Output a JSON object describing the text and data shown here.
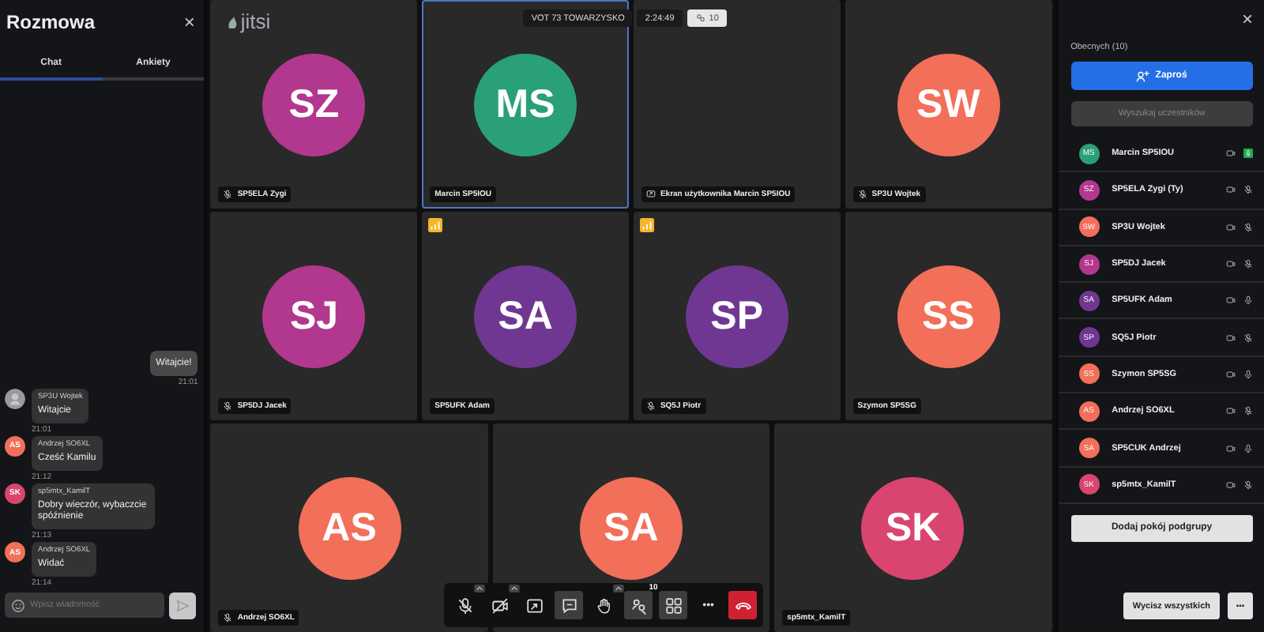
{
  "chat": {
    "title": "Rozmowa",
    "close": "×",
    "tabs": [
      {
        "label": "Chat",
        "selected": true
      },
      {
        "label": "Ankiety",
        "selected": false
      }
    ],
    "messages": [
      {
        "kind": "sent",
        "text": "Witajcie!",
        "time": "21:01"
      },
      {
        "kind": "received",
        "name": "SP3U Wojtek",
        "text": "Witajcie",
        "time": "21:01"
      },
      {
        "kind": "received",
        "initials": "AS",
        "color": "#f26f5a",
        "name": "Andrzej SO6XL",
        "text": "Cześć Kamilu",
        "time": "21:12"
      },
      {
        "kind": "received",
        "initials": "SK",
        "color": "#d9456e",
        "name": "sp5mtx_KamilT",
        "text": "Dobry wieczór, wybaczcie spóźnienie",
        "time": "21:13"
      },
      {
        "kind": "received",
        "initials": "AS",
        "color": "#f26f5a",
        "name": "Andrzej SO6XL",
        "text": "Widać",
        "time": "21:14"
      }
    ],
    "input": {
      "placeholder": "Wpisz wiadomość"
    }
  },
  "conference": {
    "logo": "jitsi",
    "title": "VOT 73 TOWARZYSKO",
    "timer": "2:24:49",
    "participants": "10"
  },
  "tiles": [
    [
      {
        "kind": "avatar",
        "initials": "SZ",
        "color": "#b2378e",
        "label": "SP5ELA Zygi",
        "muted": true,
        "selected": false,
        "signal": false
      },
      {
        "kind": "avatar",
        "initials": "MS",
        "color": "#2aa077",
        "label": "Marcin SP5IOU",
        "muted": false,
        "selected": true,
        "signal": false
      },
      {
        "kind": "screen",
        "label": "Ekran użytkownika Marcin SP5IOU",
        "muted": false,
        "selected": false,
        "signal": false
      },
      {
        "kind": "avatar",
        "initials": "SW",
        "color": "#f26f5a",
        "label": "SP3U Wojtek",
        "muted": true,
        "selected": false,
        "signal": false
      }
    ],
    [
      {
        "kind": "avatar",
        "initials": "SJ",
        "color": "#b2378e",
        "label": "SP5DJ Jacek",
        "muted": true,
        "selected": false,
        "signal": false
      },
      {
        "kind": "avatar",
        "initials": "SA",
        "color": "#6f3792",
        "label": "SP5UFK Adam",
        "muted": false,
        "selected": false,
        "signal": true
      },
      {
        "kind": "avatar",
        "initials": "SP",
        "color": "#6f3792",
        "label": "SQ5J Piotr",
        "muted": true,
        "selected": false,
        "signal": true
      },
      {
        "kind": "avatar",
        "initials": "SS",
        "color": "#f26f5a",
        "label": "Szymon SP5SG",
        "muted": false,
        "selected": false,
        "signal": false
      }
    ],
    [
      {
        "kind": "avatar",
        "initials": "AS",
        "color": "#f26f5a",
        "label": "Andrzej SO6XL",
        "muted": true,
        "selected": false,
        "signal": false
      },
      {
        "kind": "avatar",
        "initials": "SA",
        "color": "#f26f5a",
        "selected": false,
        "signal": false
      },
      {
        "kind": "avatar",
        "initials": "SK",
        "color": "#d9456e",
        "label": "sp5mtx_KamilT",
        "muted": false,
        "selected": false,
        "signal": false
      }
    ]
  ],
  "toolbar": [
    {
      "kind": "mic",
      "caret": true,
      "selected": false
    },
    {
      "kind": "camera",
      "caret": true,
      "selected": false
    },
    {
      "kind": "share",
      "caret": false,
      "selected": false
    },
    {
      "kind": "chat",
      "caret": false,
      "selected": true
    },
    {
      "kind": "hand",
      "caret": true,
      "selected": false
    },
    {
      "kind": "participants",
      "caret": false,
      "selected": true,
      "badge": "10"
    },
    {
      "kind": "tiles",
      "caret": false,
      "selected": true
    },
    {
      "kind": "more",
      "caret": false,
      "selected": false,
      "text": "•••"
    },
    {
      "kind": "hangup",
      "caret": false,
      "selected": false
    }
  ],
  "participants": {
    "close": "×",
    "heading": "Obecnych (10)",
    "invite": "Zaproś",
    "search": {
      "placeholder": "Wyszukaj uczestników"
    },
    "list": [
      {
        "initials": "MS",
        "color": "#2aa077",
        "name": "Marcin SP5IOU",
        "muted": false,
        "speaking": true
      },
      {
        "initials": "SZ",
        "color": "#b2378e",
        "name": "SP5ELA Zygi (Ty)",
        "muted": true,
        "speaking": false
      },
      {
        "initials": "SW",
        "color": "#f26f5a",
        "name": "SP3U Wojtek",
        "muted": true,
        "speaking": false
      },
      {
        "initials": "SJ",
        "color": "#b2378e",
        "name": "SP5DJ Jacek",
        "muted": true,
        "speaking": false
      },
      {
        "initials": "SA",
        "color": "#6f3792",
        "name": "SP5UFK Adam",
        "muted": false,
        "speaking": false
      },
      {
        "initials": "SP",
        "color": "#6f3792",
        "name": "SQ5J Piotr",
        "muted": true,
        "speaking": false
      },
      {
        "initials": "SS",
        "color": "#f26f5a",
        "name": "Szymon SP5SG",
        "muted": false,
        "speaking": false
      },
      {
        "initials": "AS",
        "color": "#f26f5a",
        "name": "Andrzej SO6XL",
        "muted": true,
        "speaking": false
      },
      {
        "initials": "SA",
        "color": "#f26f5a",
        "name": "SP5CUK Andrzej",
        "muted": false,
        "speaking": false
      },
      {
        "initials": "SK",
        "color": "#d9456e",
        "name": "sp5mtx_KamilT",
        "muted": true,
        "speaking": false
      }
    ],
    "add_room": "Dodaj pokój podgrupy",
    "mute_all": "Wycisz wszystkich",
    "more": "•••"
  }
}
